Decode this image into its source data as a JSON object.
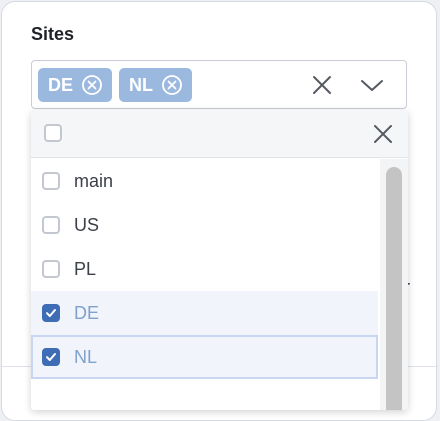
{
  "field": {
    "label": "Sites",
    "selected_chips": [
      {
        "label": "DE"
      },
      {
        "label": "NL"
      }
    ]
  },
  "dropdown": {
    "select_all_checked": false,
    "options": [
      {
        "label": "main",
        "checked": false
      },
      {
        "label": "US",
        "checked": false
      },
      {
        "label": "PL",
        "checked": false
      },
      {
        "label": "DE",
        "checked": true
      },
      {
        "label": "NL",
        "checked": true
      }
    ]
  },
  "background": {
    "partial_text": "r"
  },
  "colors": {
    "chip_bg": "#9bb9df",
    "checkbox_checked": "#3f6db5",
    "selected_text": "#7fa1cf"
  },
  "icons": {
    "chip_remove": "circle-x-icon",
    "clear": "close-icon",
    "toggle": "chevron-down-icon",
    "dropdown_close": "close-icon",
    "check": "checkmark-icon"
  }
}
